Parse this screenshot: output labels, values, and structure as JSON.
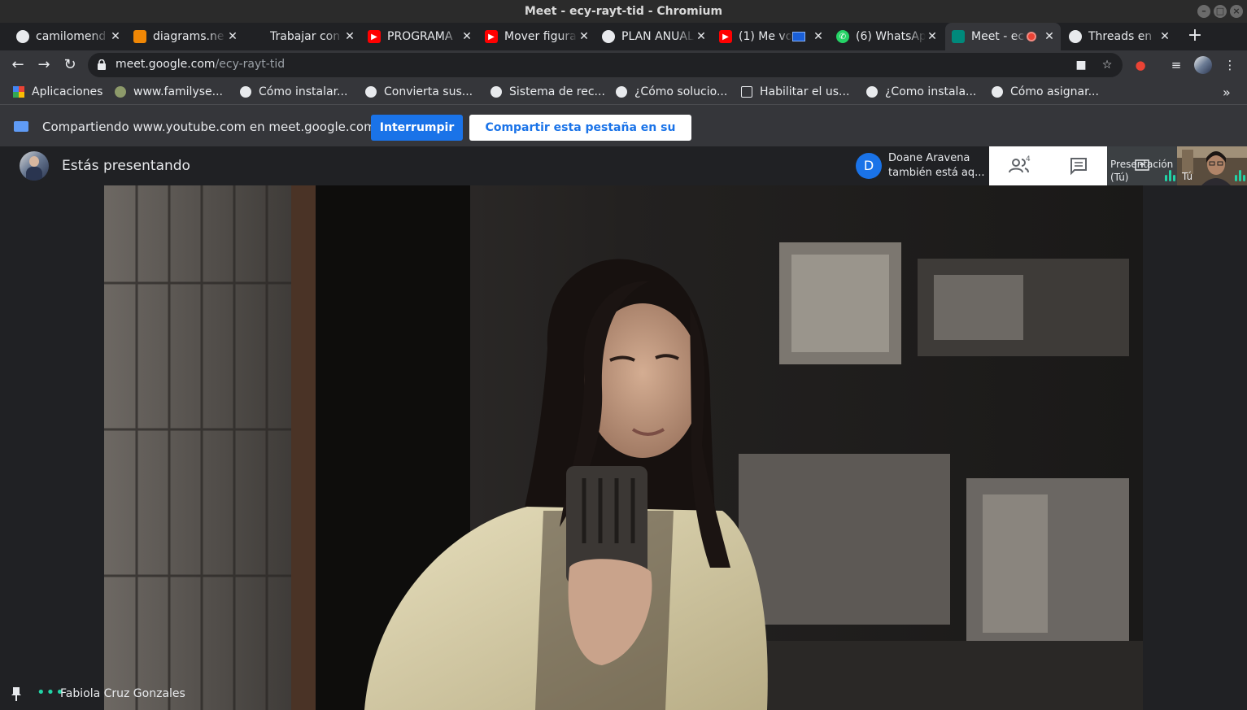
{
  "window": {
    "title": "Meet - ecy-rayt-tid - Chromium"
  },
  "tabs": [
    {
      "label": "camilomend",
      "icon": "github-icon"
    },
    {
      "label": "diagrams.ne",
      "icon": "diagrams-icon"
    },
    {
      "label": "Trabajar con",
      "icon": "blank-icon"
    },
    {
      "label": "PROGRAMA",
      "icon": "youtube-icon"
    },
    {
      "label": "Mover figura",
      "icon": "youtube-icon"
    },
    {
      "label": "PLAN ANUAL",
      "icon": "globe-icon"
    },
    {
      "label": "(1) Me vo",
      "icon": "youtube-icon"
    },
    {
      "label": "(6) WhatsApp",
      "icon": "whatsapp-icon"
    },
    {
      "label": "Meet - ec",
      "icon": "meet-icon",
      "active": true
    },
    {
      "label": "Threads en",
      "icon": "globe-icon"
    }
  ],
  "omnibox": {
    "host": "meet.google.com",
    "path": "/ecy-rayt-tid"
  },
  "bookmarks": [
    {
      "label": "Aplicaciones"
    },
    {
      "label": "www.familyse..."
    },
    {
      "label": "Cómo instalar..."
    },
    {
      "label": "Convierta sus..."
    },
    {
      "label": "Sistema de rec..."
    },
    {
      "label": "¿Cómo solucio..."
    },
    {
      "label": "Habilitar el us..."
    },
    {
      "label": "¿Como instala..."
    },
    {
      "label": "Cómo asignar..."
    }
  ],
  "sharebar": {
    "text": "Compartiendo www.youtube.com en meet.google.com",
    "stop_label": "Interrumpir",
    "switch_label": "Compartir esta pestaña en su lugar"
  },
  "meet": {
    "presenting_label": "Estás presentando",
    "notification": {
      "initial": "D",
      "line1": "Doane Aravena",
      "line2": "también está aq..."
    },
    "people_count": "4",
    "tile_presentation": {
      "line1": "Presentación",
      "line2": "(Tú)"
    },
    "tile_self": {
      "label": "Tú"
    },
    "participant_name": "Fabiola Cruz Gonzales",
    "colors": {
      "accent": "#1a73e8",
      "speaking": "#22d3a6"
    }
  }
}
